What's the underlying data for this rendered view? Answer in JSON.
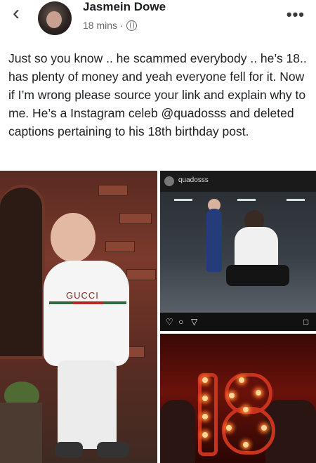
{
  "header": {
    "back_icon": "chevron-left-icon",
    "author_name": "Jasmein Dowe",
    "timestamp": "18 mins",
    "separator": "·",
    "privacy_icon": "globe-icon",
    "more_icon": "more-horizontal-icon",
    "more_label": "•••"
  },
  "post": {
    "text": "Just so you know .. he scammed everybody .. he’s 18.. has plenty of money and yeah everyone fell for it. Now if I’m wrong please source your link and explain why to me. He’s a Instagram celeb @quadosss and deleted captions pertaining to his 18th birthday post."
  },
  "photos": {
    "photo1": {
      "logo_text": "GUCCI"
    },
    "photo2": {
      "username": "quadosss",
      "action_icons": [
        "heart-icon",
        "comment-icon",
        "share-icon",
        "bookmark-icon"
      ]
    },
    "photo3": {
      "number_sign": "18"
    }
  }
}
